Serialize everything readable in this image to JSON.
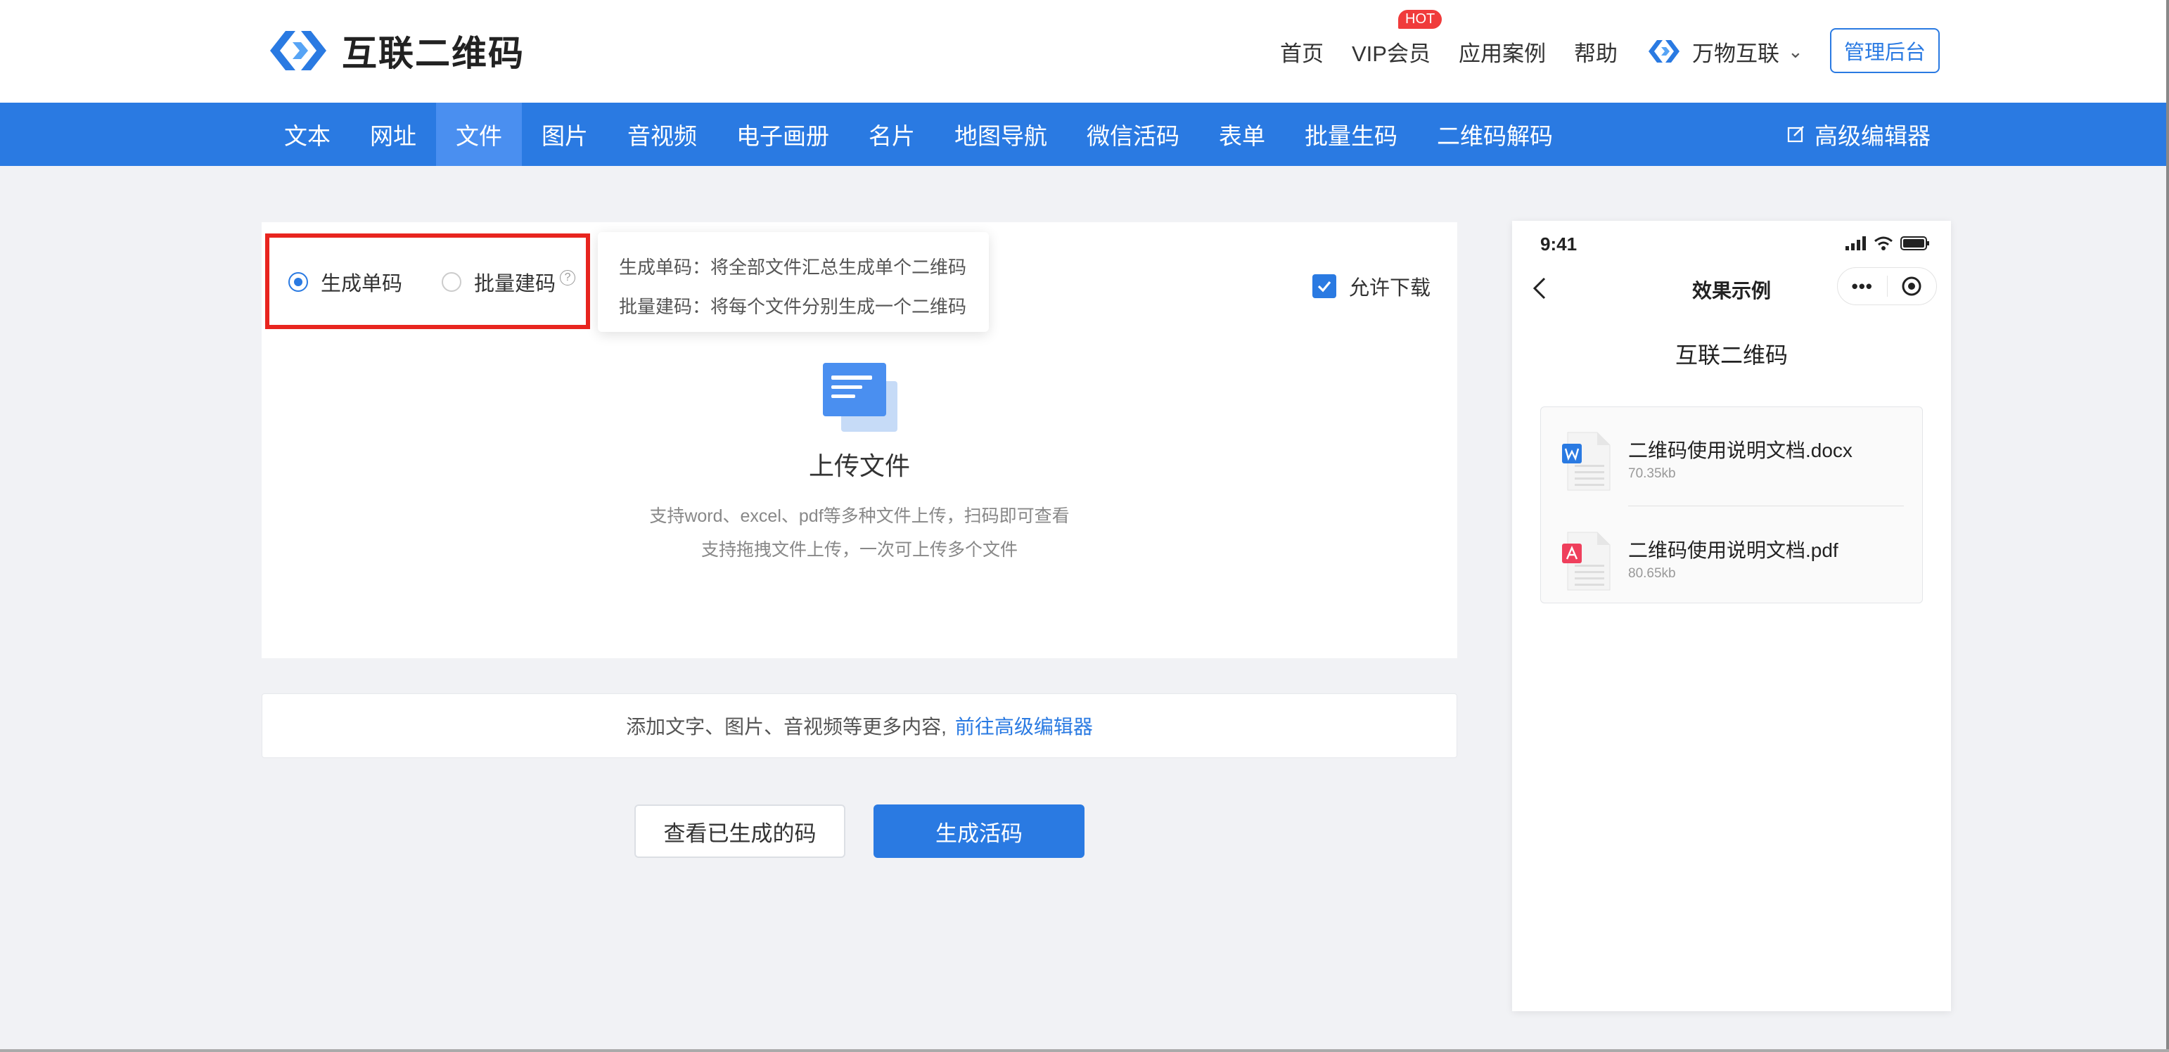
{
  "header": {
    "logo_text": "互联二维码",
    "nav": [
      "首页",
      "VIP会员",
      "应用案例",
      "帮助"
    ],
    "hot_badge": "HOT",
    "brand_switch": "万物互联",
    "admin_button": "管理后台"
  },
  "main_nav": {
    "tabs": [
      "文本",
      "网址",
      "文件",
      "图片",
      "音视频",
      "电子画册",
      "名片",
      "地图导航",
      "微信活码",
      "表单",
      "批量生码",
      "二维码解码"
    ],
    "active_tab": "文件",
    "advanced_editor": "高级编辑器"
  },
  "mode": {
    "single_label": "生成单码",
    "batch_label": "批量建码",
    "selected": "生成单码",
    "help_mark": "?"
  },
  "tooltip": {
    "line1": "生成单码：将全部文件汇总生成单个二维码",
    "line2": "批量建码：将每个文件分别生成一个二维码"
  },
  "allow_download": {
    "label": "允许下载",
    "checked": true
  },
  "upload": {
    "title": "上传文件",
    "hint1": "支持word、excel、pdf等多种文件上传，扫码即可查看",
    "hint2": "支持拖拽文件上传，一次可上传多个文件"
  },
  "add_content": {
    "text": "添加文字、图片、音视频等更多内容,",
    "link": "前往高级编辑器"
  },
  "actions": {
    "view_generated": "查看已生成的码",
    "generate": "生成活码"
  },
  "phone": {
    "time": "9:41",
    "title": "效果示例",
    "more_dots": "•••",
    "subtitle": "互联二维码",
    "files": [
      {
        "name": "二维码使用说明文档.docx",
        "size": "70.35kb",
        "type": "word"
      },
      {
        "name": "二维码使用说明文档.pdf",
        "size": "80.65kb",
        "type": "pdf"
      }
    ]
  },
  "colors": {
    "primary": "#2a7ae2",
    "nav_active": "#4a8ff0",
    "highlight_box": "#e8251f",
    "hot": "#f03b3b"
  }
}
